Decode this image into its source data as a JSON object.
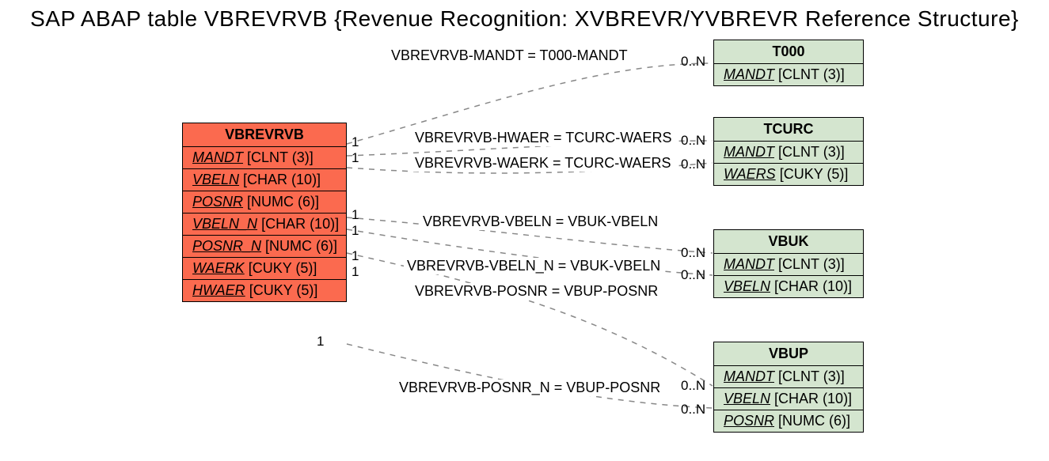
{
  "title": "SAP ABAP table VBREVRVB {Revenue Recognition: XVBREVR/YVBREVR Reference Structure}",
  "main": {
    "name": "VBREVRVB",
    "fields": [
      {
        "f": "MANDT",
        "t": "[CLNT (3)]"
      },
      {
        "f": "VBELN",
        "t": "[CHAR (10)]"
      },
      {
        "f": "POSNR",
        "t": "[NUMC (6)]"
      },
      {
        "f": "VBELN_N",
        "t": "[CHAR (10)]"
      },
      {
        "f": "POSNR_N",
        "t": "[NUMC (6)]"
      },
      {
        "f": "WAERK",
        "t": "[CUKY (5)]"
      },
      {
        "f": "HWAER",
        "t": "[CUKY (5)]"
      }
    ]
  },
  "refs": {
    "t000": {
      "name": "T000",
      "fields": [
        {
          "f": "MANDT",
          "t": "[CLNT (3)]"
        }
      ]
    },
    "tcurc": {
      "name": "TCURC",
      "fields": [
        {
          "f": "MANDT",
          "t": "[CLNT (3)]"
        },
        {
          "f": "WAERS",
          "t": "[CUKY (5)]"
        }
      ]
    },
    "vbuk": {
      "name": "VBUK",
      "fields": [
        {
          "f": "MANDT",
          "t": "[CLNT (3)]"
        },
        {
          "f": "VBELN",
          "t": "[CHAR (10)]"
        }
      ]
    },
    "vbup": {
      "name": "VBUP",
      "fields": [
        {
          "f": "MANDT",
          "t": "[CLNT (3)]"
        },
        {
          "f": "VBELN",
          "t": "[CHAR (10)]"
        },
        {
          "f": "POSNR",
          "t": "[NUMC (6)]"
        }
      ]
    }
  },
  "rel_labels": {
    "mandt": "VBREVRVB-MANDT = T000-MANDT",
    "hwaer": "VBREVRVB-HWAER = TCURC-WAERS",
    "waerk": "VBREVRVB-WAERK = TCURC-WAERS",
    "vbeln": "VBREVRVB-VBELN = VBUK-VBELN",
    "vbeln_n": "VBREVRVB-VBELN_N = VBUK-VBELN",
    "posnr": "VBREVRVB-POSNR = VBUP-POSNR",
    "posnr_n": "VBREVRVB-POSNR_N = VBUP-POSNR"
  },
  "cards": {
    "one": "1",
    "many": "0..N"
  }
}
